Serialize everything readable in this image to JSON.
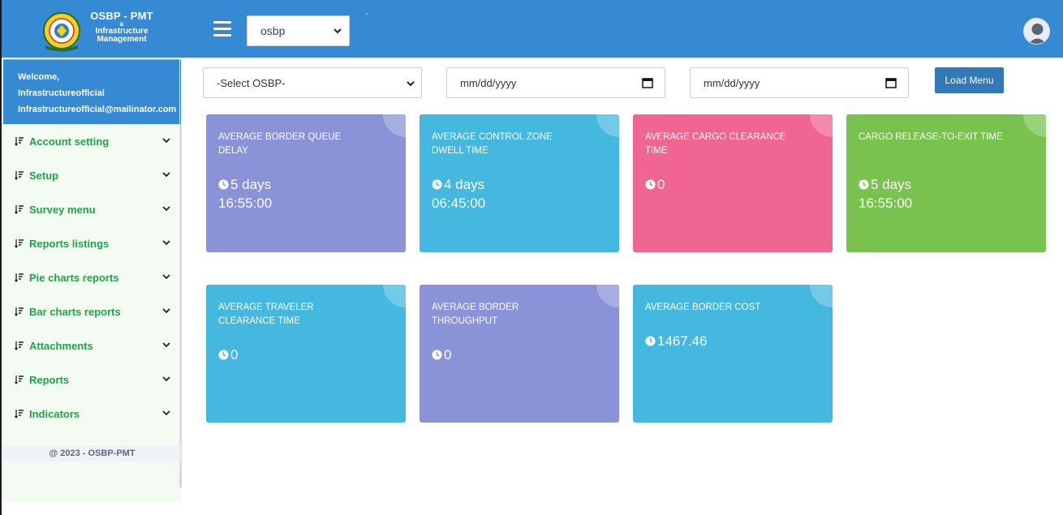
{
  "header": {
    "brand_line1": "OSBP - PMT",
    "brand_line2": "&",
    "brand_line3": "Infrastructure",
    "brand_line4": "Management",
    "org_select_value": "osbp",
    "menu_icon": "hamburger-icon",
    "avatar_icon": "user-avatar-icon",
    "colors": {
      "header_bg": "#358ad3"
    }
  },
  "sidebar": {
    "welcome_line1": "Welcome,",
    "welcome_line2": "Infrastructureofficial",
    "welcome_line3": "Infrastructureofficial@mailinator.com",
    "items": [
      {
        "label": "Account setting",
        "icon": "sort-amount-icon"
      },
      {
        "label": "Setup",
        "icon": "sort-amount-icon"
      },
      {
        "label": "Survey menu",
        "icon": "sort-amount-icon"
      },
      {
        "label": "Reports listings",
        "icon": "sort-amount-icon"
      },
      {
        "label": "Pie charts reports",
        "icon": "sort-amount-icon"
      },
      {
        "label": "Bar charts reports",
        "icon": "sort-amount-icon"
      },
      {
        "label": "Attachments",
        "icon": "sort-amount-icon"
      },
      {
        "label": "Reports",
        "icon": "sort-amount-icon"
      },
      {
        "label": "Indicators",
        "icon": "sort-amount-icon"
      }
    ],
    "footer": "@ 2023 - OSBP-PMT",
    "colors": {
      "item_text": "#1fa34a",
      "menu_bg": "#f3fbf3"
    }
  },
  "filters": {
    "osbp_select": "-Select OSBP-",
    "date_from_placeholder": "mm/dd/yyyy",
    "date_to_placeholder": "mm/dd/yyyy",
    "load_button": "Load Menu"
  },
  "cards": [
    {
      "title": "Average Border Queue Delay",
      "line1": "5 days",
      "line2": "16:55:00",
      "color": "#8a93d8"
    },
    {
      "title": "Average Control Zone Dwell Time",
      "line1": "4 days",
      "line2": "06:45:00",
      "color": "#44b8df"
    },
    {
      "title": "Average Cargo Clearance Time",
      "line1": "0",
      "line2": "",
      "color": "#f06592"
    },
    {
      "title": "Cargo Release-to-exit Time",
      "line1": "5 days",
      "line2": "16:55:00",
      "color": "#79c24f"
    },
    {
      "title": "Average Traveler Clearance Time",
      "line1": "0",
      "line2": "",
      "color": "#44b8df"
    },
    {
      "title": "Average Border Throughput",
      "line1": "0",
      "line2": "",
      "color": "#8a93d8"
    },
    {
      "title": "Average Border Cost",
      "line1": "1467.46",
      "line2": "",
      "color": "#44b8df"
    }
  ]
}
